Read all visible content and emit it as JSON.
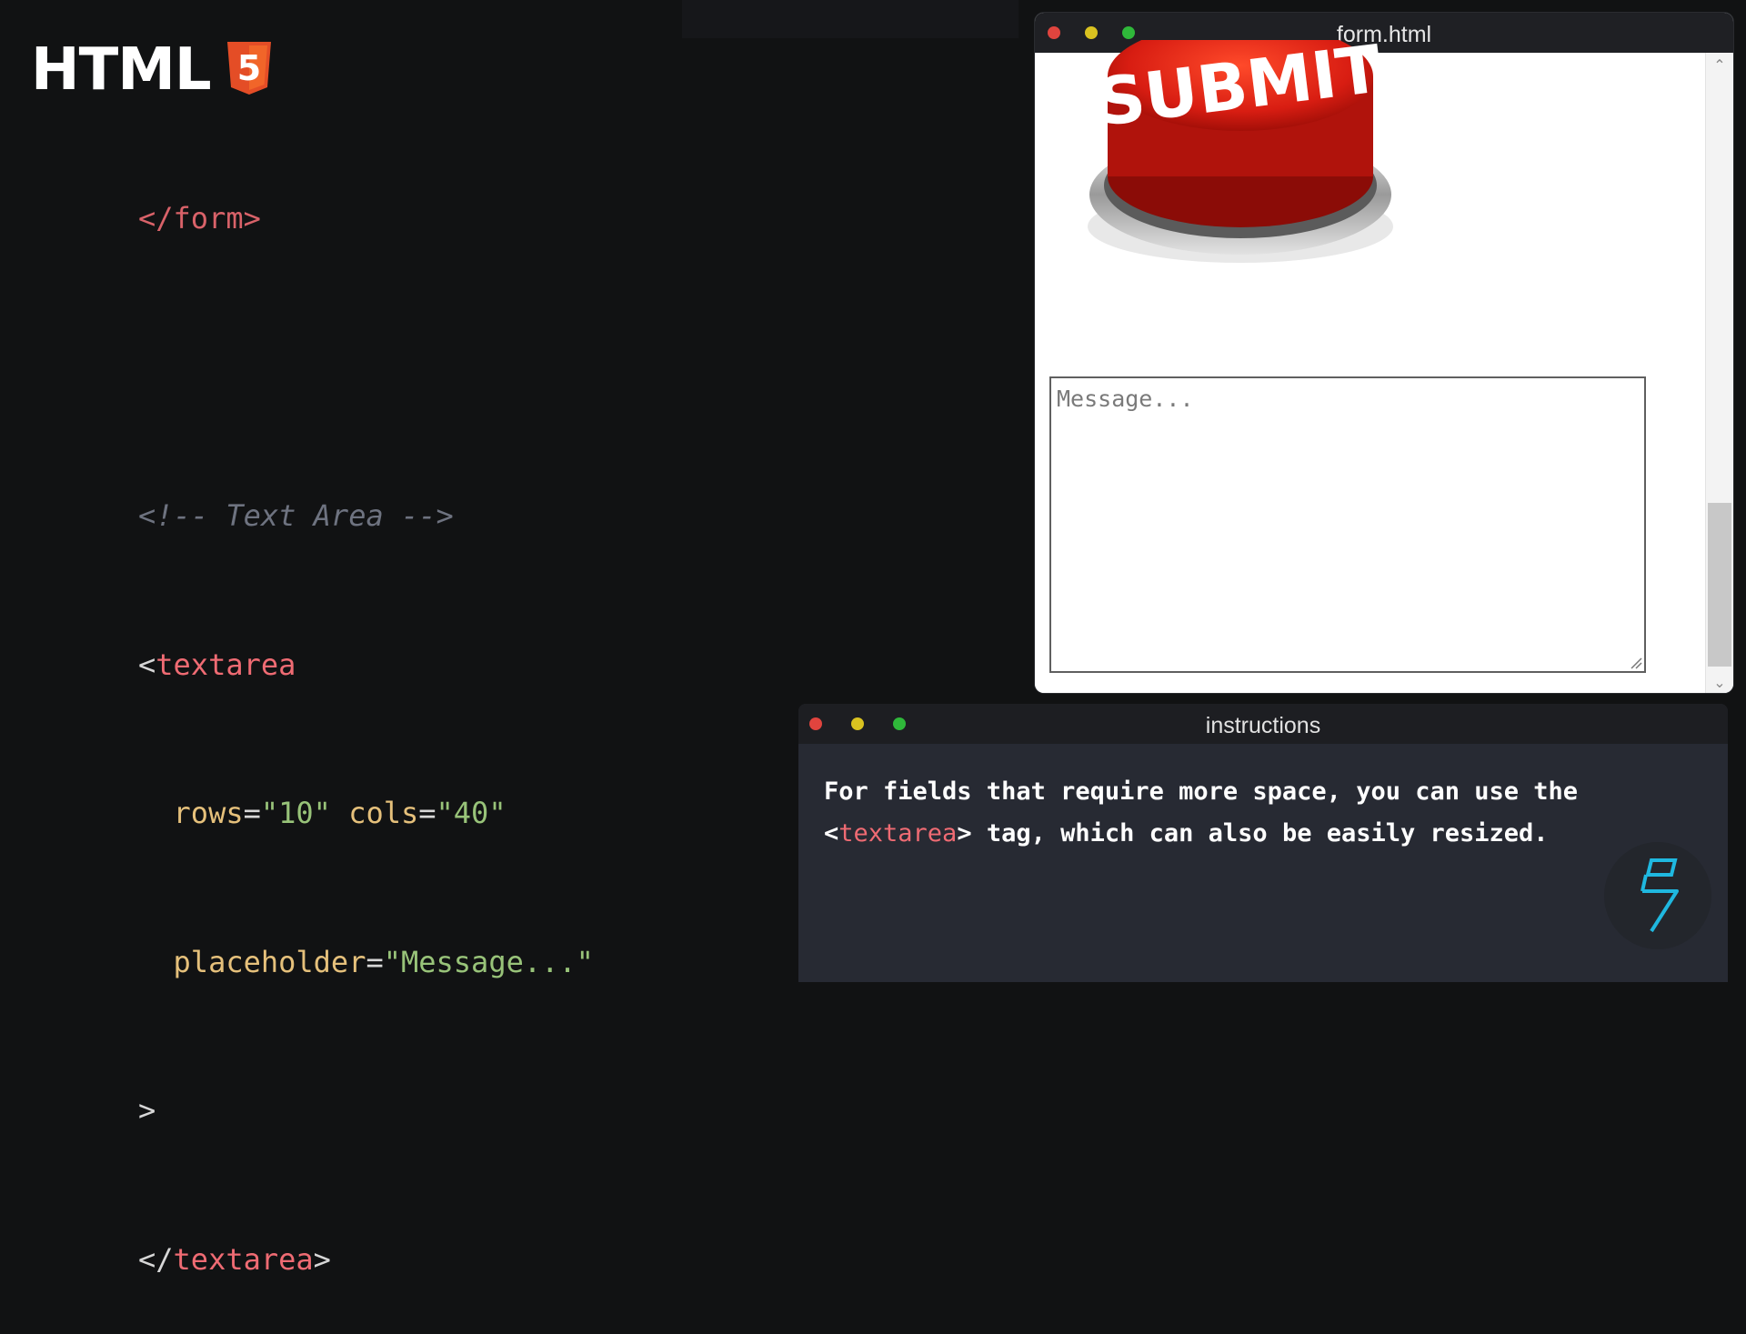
{
  "brand": {
    "title": "HTML",
    "badge_digit": "5",
    "badge_color": "#e44d26"
  },
  "code": {
    "partial_line": "</form>",
    "comment": "<!-- Text Area -->",
    "open_bracket": "<",
    "tag_name": "textarea",
    "attr_rows_name": "rows",
    "attr_rows_value": "\"10\"",
    "attr_cols_name": "cols",
    "attr_cols_value": "\"40\"",
    "attr_placeholder_name": "placeholder",
    "attr_placeholder_value": "\"Message...\"",
    "equals": "=",
    "close_bracket": ">",
    "close_open": "</",
    "close_tag_name": "textarea",
    "close_end": ">"
  },
  "browser": {
    "title": "form.html",
    "submit_text": "SUBMIT",
    "textarea_placeholder": "Message..."
  },
  "instructions": {
    "title": "instructions",
    "line1": "For fields that require more space, you can use the",
    "line2_open": "<",
    "line2_tag": "textarea",
    "line2_close": ">",
    "line2_rest": " tag, which can also be easily resized."
  },
  "colors": {
    "tag": "#ef6b73",
    "attr": "#e5c07b",
    "string": "#98c379",
    "comment": "#6e7380",
    "accent_logo": "#1fb8e0"
  }
}
